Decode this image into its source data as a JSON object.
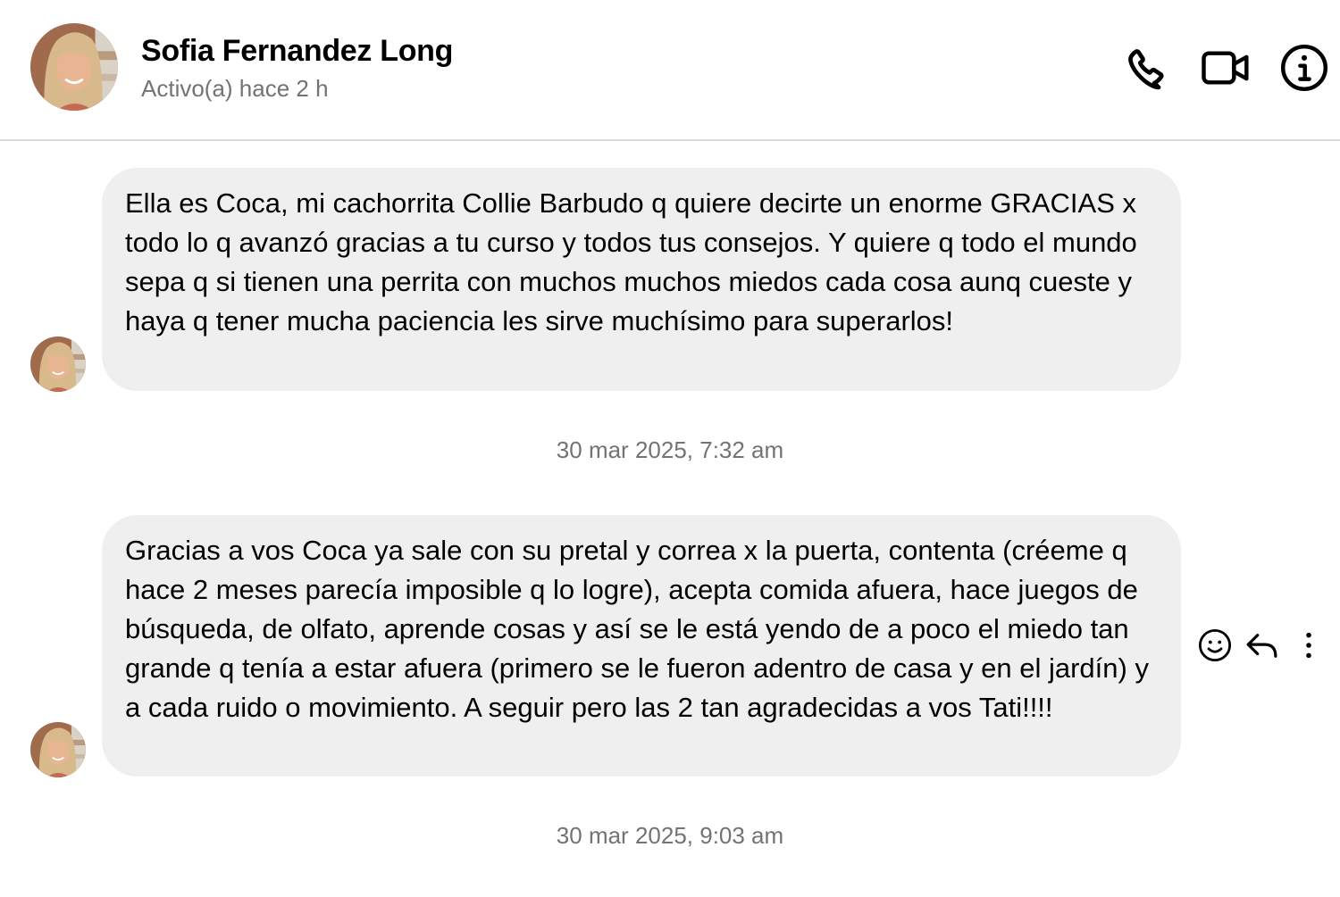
{
  "header": {
    "contact_name": "Sofia Fernandez Long",
    "status": "Activo(a) hace 2 h",
    "icons": [
      "phone-icon",
      "video-camera-icon",
      "info-icon"
    ]
  },
  "messages": [
    {
      "text": "Ella es Coca, mi cachorrita Collie Barbudo q quiere decirte un enorme GRACIAS x todo lo q avanzó gracias a tu curso y todos tus consejos. Y quiere q todo el mundo sepa q si tienen una perrita con muchos muchos miedos cada cosa aunq cueste y haya q tener mucha paciencia les sirve muchísimo para superarlos!"
    },
    {
      "timestamp": "30 mar 2025, 7:32 am",
      "text": "Gracias a vos Coca ya sale con su pretal y correa x la puerta, contenta (créeme q hace 2 meses parecía imposible q lo logre), acepta comida afuera, hace juegos de búsqueda, de olfato, aprende cosas y así se le está yendo de a poco el miedo tan grande q tenía a estar afuera (primero se le fueron adentro de casa y en el jardín) y a cada ruido o movimiento. A seguir pero las 2 tan agradecidas a vos Tati!!!!",
      "actions": [
        "smiley-icon",
        "reply-icon",
        "more-options-icon"
      ]
    }
  ],
  "footer_timestamp": "30 mar 2025, 9:03 am"
}
